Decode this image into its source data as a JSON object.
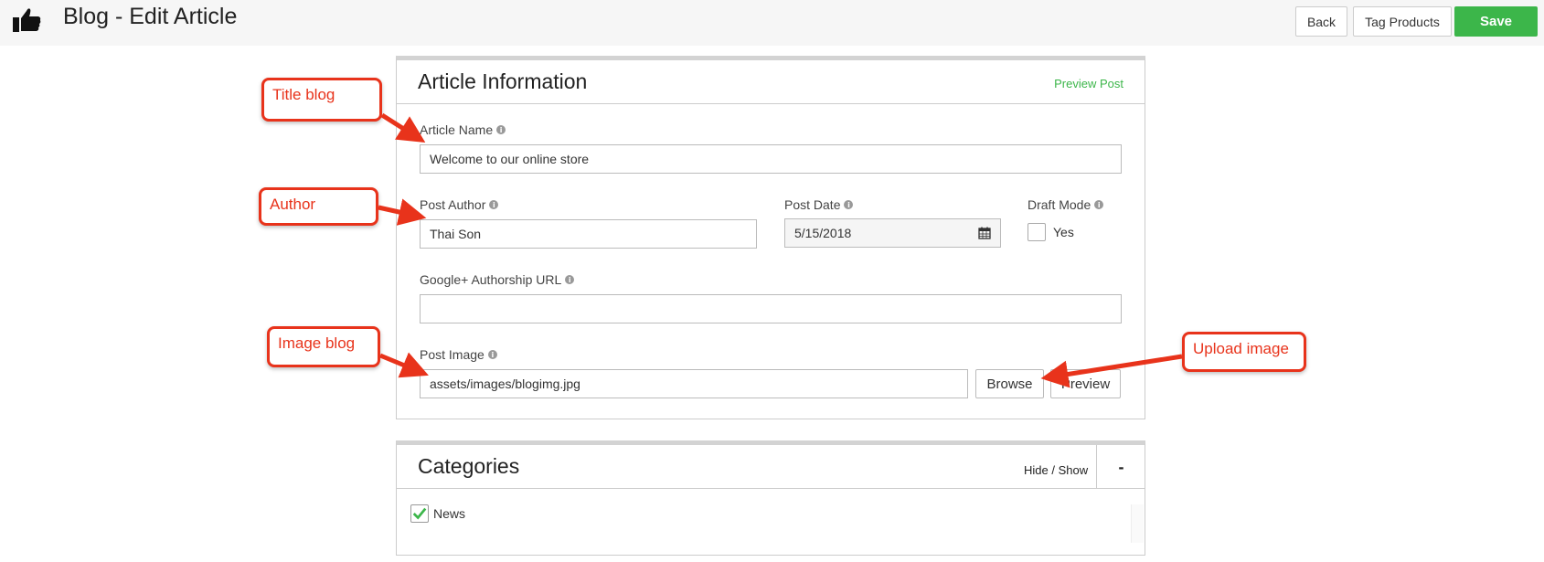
{
  "header": {
    "title": "Blog - Edit Article",
    "back_label": "Back",
    "tag_products_label": "Tag Products",
    "save_label": "Save"
  },
  "article_info": {
    "title": "Article Information",
    "preview_post_label": "Preview Post",
    "article_name": {
      "label": "Article Name",
      "value": "Welcome to our online store"
    },
    "post_author": {
      "label": "Post Author",
      "value": "Thai Son"
    },
    "post_date": {
      "label": "Post Date",
      "value": "5/15/2018"
    },
    "draft_mode": {
      "label": "Draft Mode",
      "option_label": "Yes",
      "checked": false
    },
    "google_authorship": {
      "label": "Google+ Authorship URL",
      "value": ""
    },
    "post_image": {
      "label": "Post Image",
      "value": "assets/images/blogimg.jpg",
      "browse_label": "Browse",
      "preview_label": "Preview"
    }
  },
  "categories": {
    "title": "Categories",
    "hide_show_label": "Hide / Show",
    "toggle_symbol": "-",
    "items": [
      {
        "label": "News",
        "checked": true
      }
    ]
  },
  "callouts": {
    "title_blog": "Title blog",
    "author": "Author",
    "image_blog": "Image blog",
    "upload_image": "Upload image"
  },
  "colors": {
    "accent_green": "#3cb64a",
    "callout_red": "#e8331b"
  },
  "icons": {
    "logo": "thumbs-up-icon",
    "info": "info-icon",
    "calendar": "calendar-icon",
    "check": "checkmark-icon"
  }
}
